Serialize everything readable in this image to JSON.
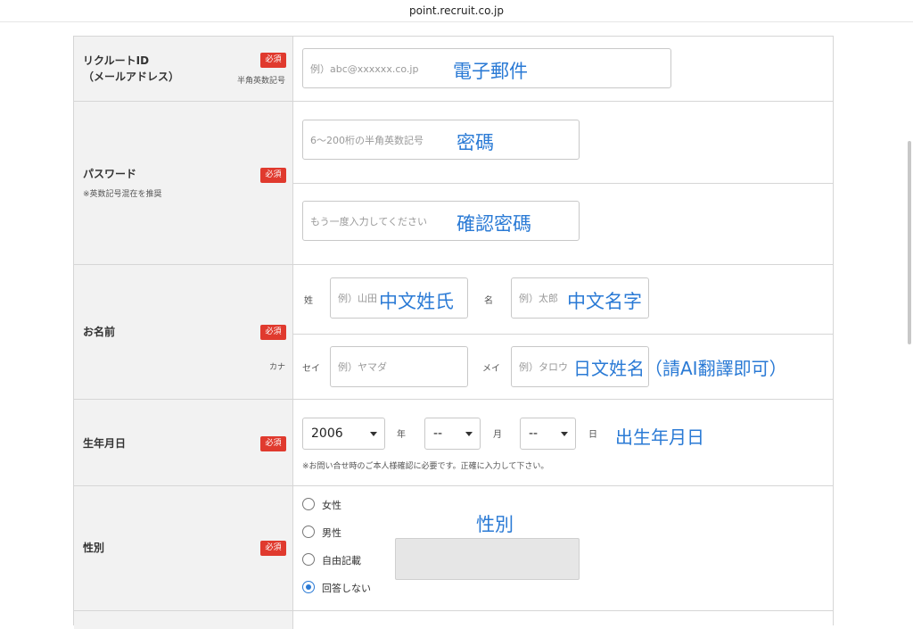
{
  "browser": {
    "url": "point.recruit.co.jp"
  },
  "required_label": "必須",
  "rows": {
    "id": {
      "title_line1": "リクルートID",
      "title_line2": "（メールアドレス）",
      "sub": "半角英数記号",
      "placeholder": "例）abc@xxxxxx.co.jp",
      "note": "電子郵件"
    },
    "password": {
      "title": "パスワード",
      "sub": "※英数記号混在を推奨",
      "placeholder": "6〜200桁の半角英数記号",
      "note": "密碼",
      "confirm_placeholder": "もう一度入力してください",
      "confirm_note": "確認密碼"
    },
    "name": {
      "title": "お名前",
      "kana_label": "カナ",
      "sei_label": "姓",
      "mei_label": "名",
      "sei_ph": "例）山田",
      "mei_ph": "例）太郎",
      "sei_note": "中文姓氏",
      "mei_note": "中文名字",
      "kana_sei_label": "セイ",
      "kana_mei_label": "メイ",
      "kana_sei_ph": "例）ヤマダ",
      "kana_mei_ph": "例）タロウ",
      "kana_note": "日文姓名（請AI翻譯即可）"
    },
    "birth": {
      "title": "生年月日",
      "year": "2006",
      "month": "--",
      "day": "--",
      "year_unit": "年",
      "month_unit": "月",
      "day_unit": "日",
      "note": "出生年月日",
      "help": "※お問い合せ時のご本人様確認に必要です。正確に入力して下さい。"
    },
    "gender": {
      "title": "性別",
      "note": "性別",
      "options": [
        "女性",
        "男性",
        "自由記載",
        "回答しない"
      ],
      "selected": "回答しない"
    }
  }
}
